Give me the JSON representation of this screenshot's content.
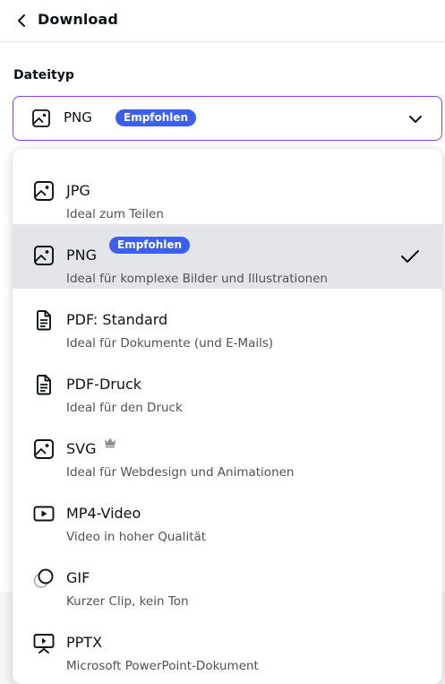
{
  "header": {
    "title": "Download",
    "back_icon": "chevron-left-icon"
  },
  "file_type": {
    "label": "Dateityp",
    "selected_value": "PNG",
    "selected_badge": "Empfohlen",
    "selected_icon": "image-icon",
    "toggle_icon": "chevron-down-icon"
  },
  "options": [
    {
      "title": "JPG",
      "desc": "Ideal zum Teilen",
      "icon": "image-icon"
    },
    {
      "title": "PNG",
      "badge": "Empfohlen",
      "desc": "Ideal für komplexe Bilder und Illustrationen",
      "icon": "image-icon",
      "selected": true
    },
    {
      "title": "PDF: Standard",
      "desc": "Ideal für Dokumente (und E-Mails)",
      "icon": "document-icon"
    },
    {
      "title": "PDF-Druck",
      "desc": "Ideal für den Druck",
      "icon": "document-icon"
    },
    {
      "title": "SVG",
      "desc": "Ideal für Webdesign und Animationen",
      "icon": "image-icon",
      "pro_icon": "crown-icon"
    },
    {
      "title": "MP4-Video",
      "desc": "Video in hoher Qualität",
      "icon": "video-play-icon"
    },
    {
      "title": "GIF",
      "desc": "Kurzer Clip, kein Ton",
      "icon": "gif-circles-icon"
    },
    {
      "title": "PPTX",
      "desc": "Microsoft PowerPoint-Dokument",
      "icon": "presentation-icon"
    }
  ],
  "colors": {
    "accent": "#8b3dff",
    "badge": "#3b5ff3",
    "selected_row": "#e3e5e8"
  }
}
